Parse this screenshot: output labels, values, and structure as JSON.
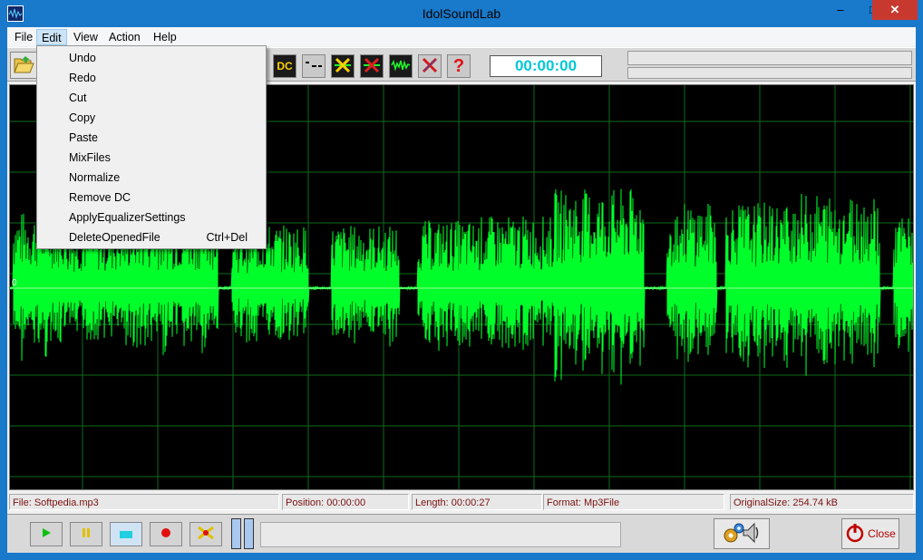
{
  "window": {
    "title": "IdolSoundLab",
    "minimize": "–",
    "maximize": "□",
    "close": "✕"
  },
  "menubar": {
    "items": [
      "File",
      "Edit",
      "View",
      "Action",
      "Help"
    ]
  },
  "toolbar": {
    "time": "00:00:00",
    "dc_label": "DC"
  },
  "edit_menu": {
    "items": [
      {
        "label": "Undo",
        "shortcut": ""
      },
      {
        "label": "Redo",
        "shortcut": ""
      },
      {
        "label": "Cut",
        "shortcut": ""
      },
      {
        "label": "Copy",
        "shortcut": ""
      },
      {
        "label": "Paste",
        "shortcut": ""
      },
      {
        "label": "MixFiles",
        "shortcut": ""
      },
      {
        "label": "Normalize",
        "shortcut": ""
      },
      {
        "label": "Remove DC",
        "shortcut": ""
      },
      {
        "label": "ApplyEqualizerSettings",
        "shortcut": ""
      },
      {
        "label": "DeleteOpenedFile",
        "shortcut": "Ctrl+Del"
      }
    ]
  },
  "waveform": {
    "axis_zero_label": "0",
    "color": "#00ff2a",
    "grid_color": "#0b6b1a"
  },
  "status": {
    "file": "File: Softpedia.mp3",
    "position": "Position: 00:00:00",
    "length": "Length: 00:00:27",
    "format": "Format:  Mp3File",
    "original_size": "OriginalSize: 254.74 kB"
  },
  "transport": {
    "close_label": "Close"
  },
  "icons": {
    "open": "folder-open-icon",
    "dc": "dc-icon",
    "silence": "silence-icon",
    "cross_green": "delete-green-icon",
    "cross_red": "delete-red-icon",
    "wave": "wave-icon",
    "no": "cancel-icon",
    "help": "help-icon",
    "play": "play-icon",
    "pause": "pause-icon",
    "stop": "stop-icon",
    "record": "record-icon",
    "clear": "clear-icon",
    "settings": "settings-speaker-icon",
    "power": "power-icon"
  },
  "colors": {
    "accent": "#1979ca",
    "time_text": "#00c8d8",
    "status_text": "#7a1010",
    "close_text": "#b00000"
  }
}
